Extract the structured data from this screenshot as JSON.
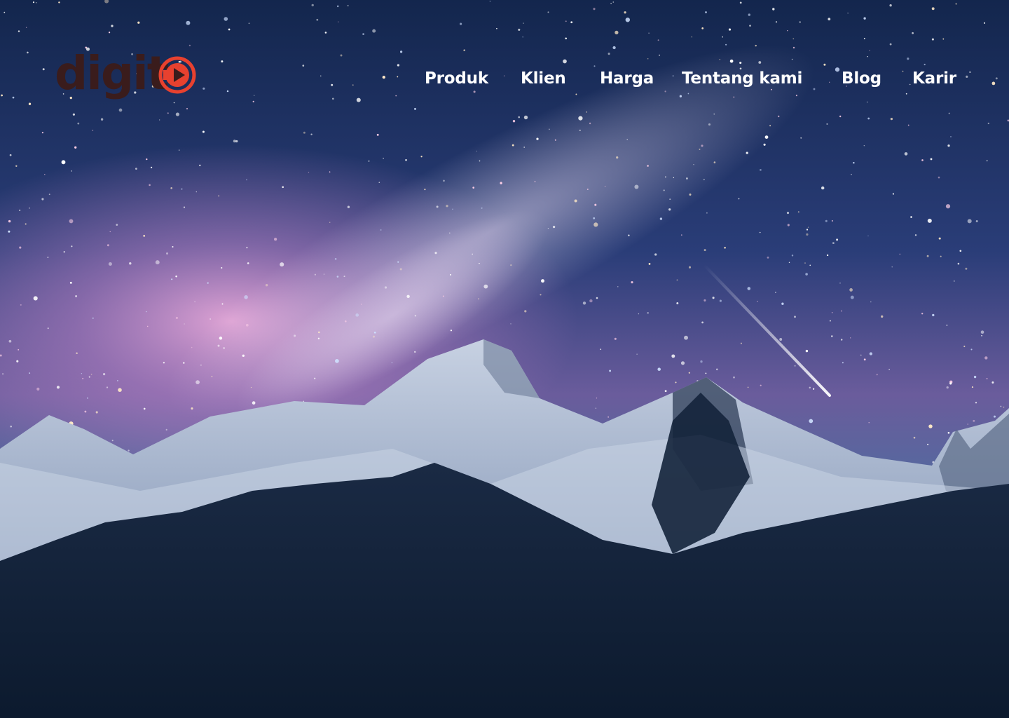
{
  "brand": {
    "logo_text": "digit",
    "logo_text_color": "#3a1c1c",
    "logo_mark_color": "#e8412f",
    "logo_mark_icon": "play-circle-icon"
  },
  "nav": {
    "items": [
      {
        "label": "Produk"
      },
      {
        "label": "Klien"
      },
      {
        "label": "Harga"
      },
      {
        "label": "Tentang kami"
      },
      {
        "label": "Blog"
      },
      {
        "label": "Karir"
      }
    ],
    "text_color": "#ffffff"
  },
  "hero": {
    "background": "night-sky-mountains-milky-way",
    "colors": {
      "sky_top": "#1c2b57",
      "sky_glow": "#c58bc9",
      "horizon": "#4b7aa8",
      "snow": "#dfe6f0",
      "forest": "#0f1d33"
    }
  }
}
